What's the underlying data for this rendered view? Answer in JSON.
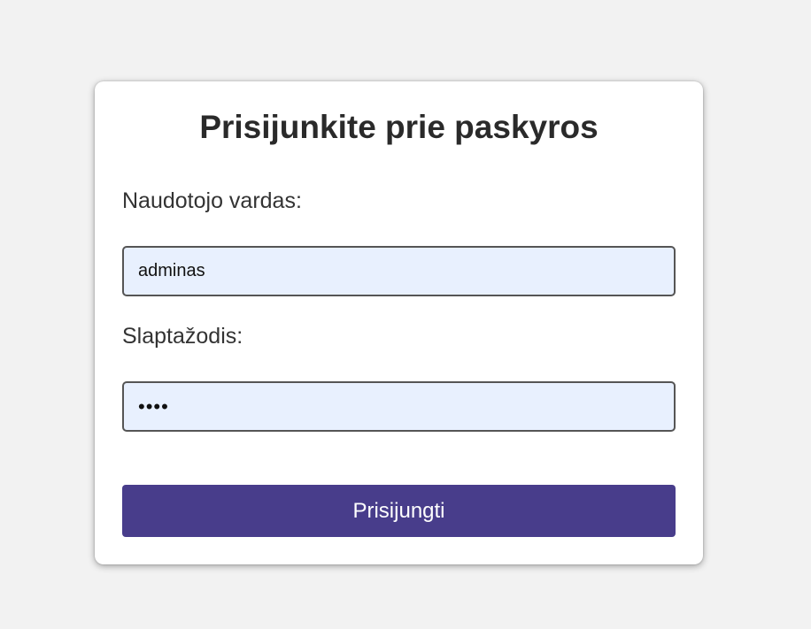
{
  "login_form": {
    "title": "Prisijunkite prie paskyros",
    "username_label": "Naudotojo vardas:",
    "username_value": "adminas",
    "password_label": "Slaptažodis:",
    "password_value": "••••",
    "submit_label": "Prisijungti"
  },
  "colors": {
    "background": "#f2f2f2",
    "card": "#ffffff",
    "input_fill": "#e8f0fe",
    "button": "#483d8b",
    "button_text": "#ffffff"
  }
}
